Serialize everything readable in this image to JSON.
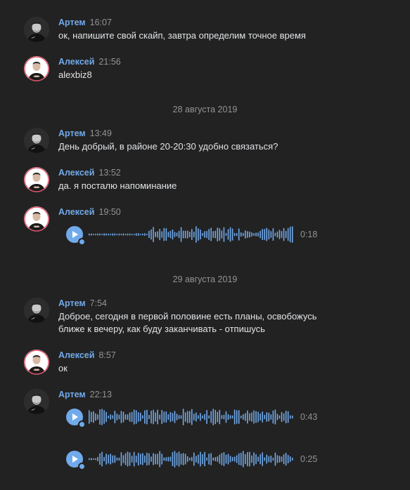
{
  "messages": [
    {
      "author": "Артем",
      "time": "16:07",
      "text": "ок, напишите свой скайп, завтра определим точное время"
    },
    {
      "author": "Алексей",
      "time": "21:56",
      "text": "alexbiz8"
    },
    {
      "author": "Артем",
      "time": "13:49",
      "text": "День добрый, в районе 20-20:30 удобно связаться?"
    },
    {
      "author": "Алексей",
      "time": "13:52",
      "text": "да. я посталю напоминание"
    },
    {
      "author": "Алексей",
      "time": "19:50"
    },
    {
      "author": "Артем",
      "time": "7:54",
      "text_line1": "Доброе, сегодня в первой половине есть планы, освобожусь",
      "text_line2": "ближе к вечеру, как буду заканчивать - отпишусь"
    },
    {
      "author": "Алексей",
      "time": "8:57",
      "text": "ок"
    },
    {
      "author": "Артем",
      "time": "22:13"
    }
  ],
  "dates": [
    "28 августа 2019",
    "29 августа 2019"
  ],
  "voice_messages": [
    {
      "duration": "0:18",
      "icon": "play-icon"
    },
    {
      "duration": "0:43",
      "icon": "play-icon"
    },
    {
      "duration": "0:25",
      "icon": "play-icon"
    }
  ],
  "colors": {
    "background": "#222222",
    "author": "#71aaeb",
    "text": "#e1e3e6",
    "muted": "#939393",
    "accent": "#71aaeb"
  }
}
